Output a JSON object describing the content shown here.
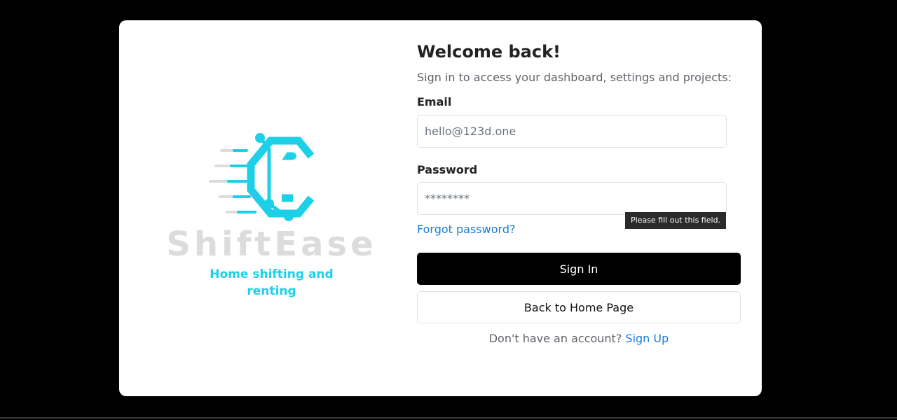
{
  "brand": {
    "name": "ShiftEase",
    "tagline": "Home shifting and renting",
    "logo_icon": "shiftease-c-circuit-logo-icon",
    "accent_color": "#1dd0e8"
  },
  "form": {
    "title": "Welcome back!",
    "subtitle": "Sign in to access your dashboard, settings and projects:",
    "email": {
      "label": "Email",
      "placeholder": "hello@123d.one",
      "value": ""
    },
    "password": {
      "label": "Password",
      "placeholder": "********",
      "value": ""
    },
    "validation_tooltip": "Please fill out this field.",
    "forgot_password_label": "Forgot password?",
    "sign_in_label": "Sign In",
    "back_home_label": "Back to Home Page",
    "signup_prompt": "Don't have an account?",
    "signup_link_label": "Sign Up",
    "link_color": "#1b7bd6"
  }
}
